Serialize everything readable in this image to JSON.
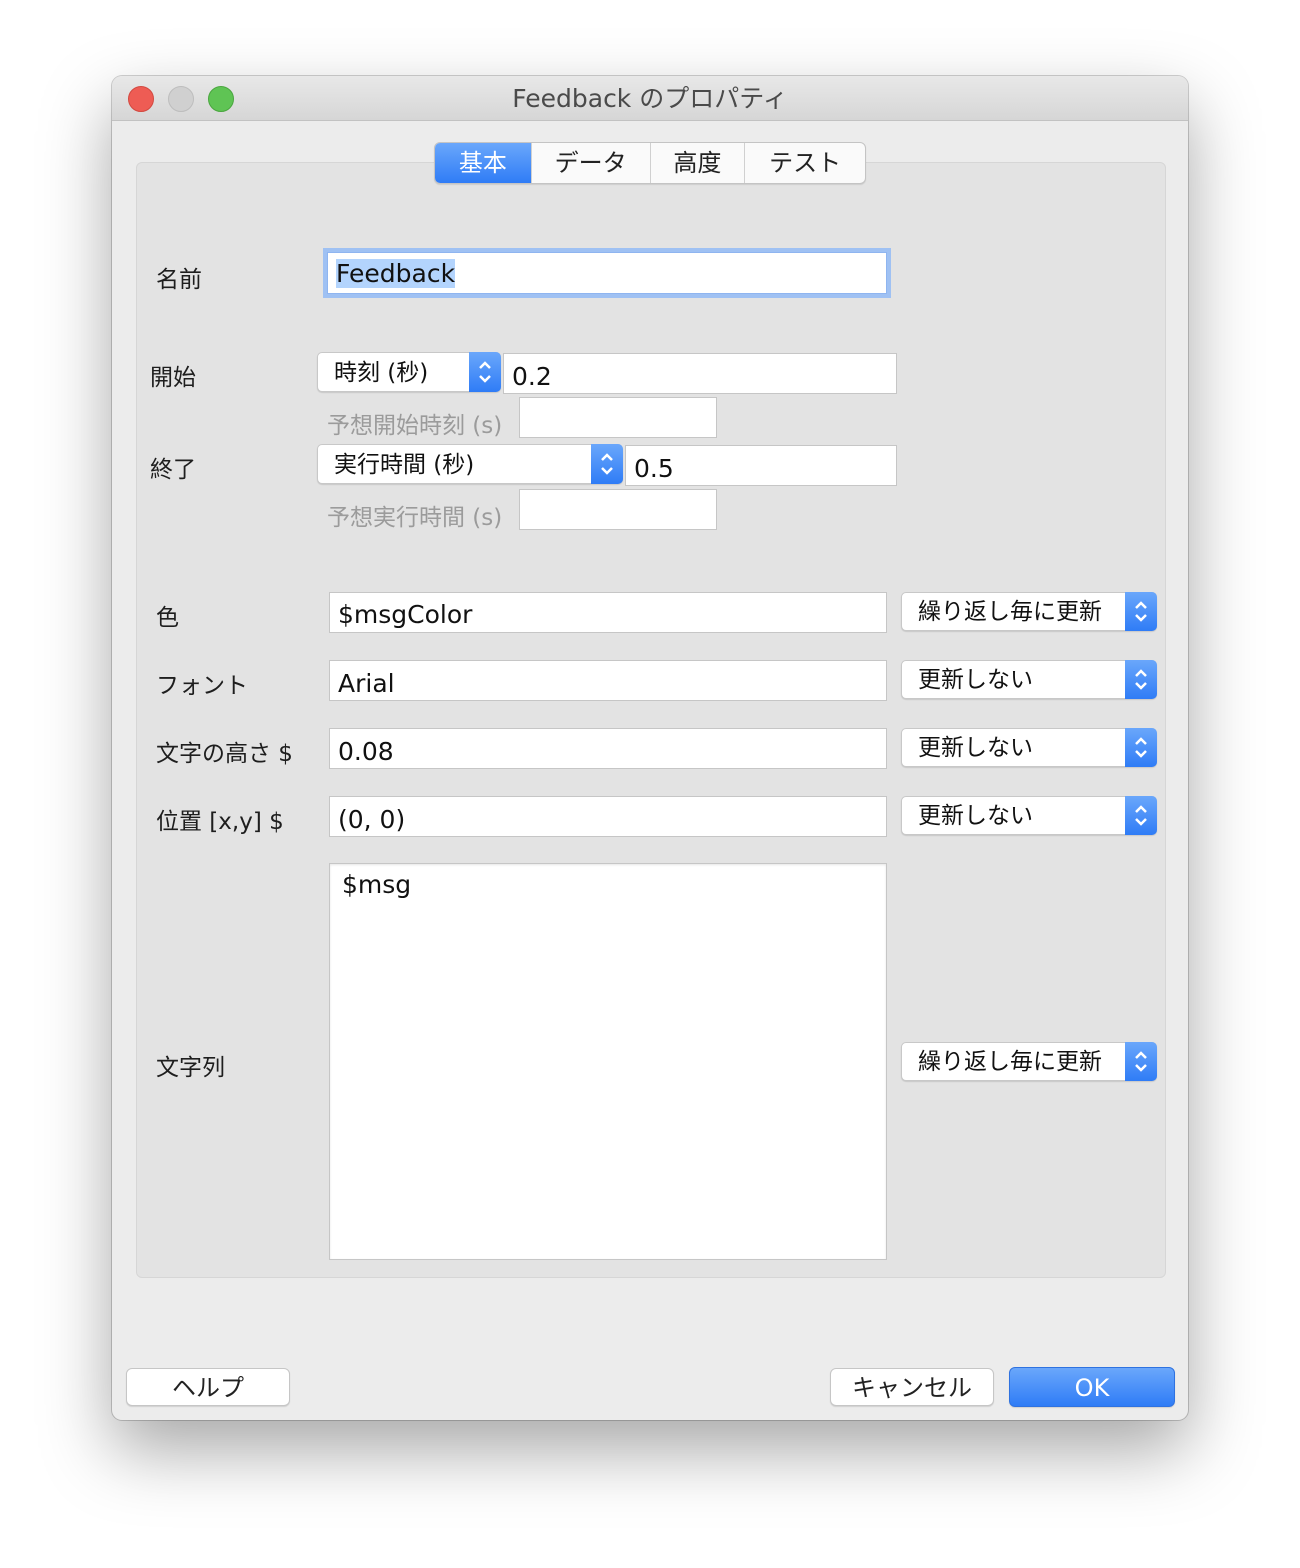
{
  "window": {
    "title": "Feedback のプロパティ"
  },
  "tabs": [
    {
      "label": "基本",
      "active": true
    },
    {
      "label": "データ",
      "active": false
    },
    {
      "label": "高度",
      "active": false
    },
    {
      "label": "テスト",
      "active": false
    }
  ],
  "name": {
    "label": "名前",
    "value": "Feedback"
  },
  "start": {
    "label": "開始",
    "type_value": "時刻 (秒)",
    "value": "0.2",
    "expected_label": "予想開始時刻 (s)",
    "expected_value": ""
  },
  "stop": {
    "label": "終了",
    "type_value": "実行時間 (秒)",
    "value": "0.5",
    "expected_label": "予想実行時間 (s)",
    "expected_value": ""
  },
  "color": {
    "label": "色",
    "value": "$msgColor",
    "update": "繰り返し毎に更新"
  },
  "font": {
    "label": "フォント",
    "value": "Arial",
    "update": "更新しない"
  },
  "height": {
    "label": "文字の高さ $",
    "value": "0.08",
    "update": "更新しない"
  },
  "position": {
    "label": "位置 [x,y] $",
    "value": "(0, 0)",
    "update": "更新しない"
  },
  "text": {
    "label": "文字列",
    "value": "$msg",
    "update": "繰り返し毎に更新"
  },
  "buttons": {
    "help": "ヘルプ",
    "cancel": "キャンセル",
    "ok": "OK"
  },
  "colors": {
    "accent": "#2f7cf6",
    "background": "#ececec",
    "panel": "#e3e3e3"
  }
}
